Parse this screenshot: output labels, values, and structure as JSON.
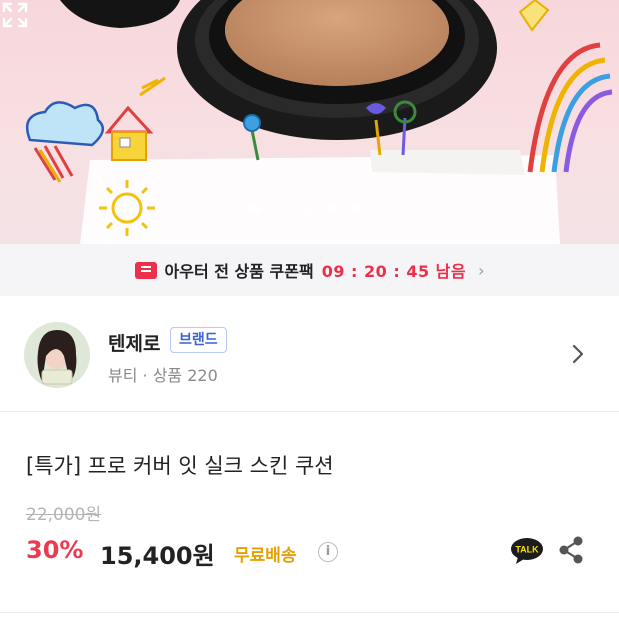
{
  "hero": {
    "slide_count": 5,
    "active_slide": 1,
    "expand_icon": "expand-icon"
  },
  "coupon": {
    "icon": "coupon-icon",
    "text": "아우터 전 상품 쿠폰팩",
    "timer": "09 : 20 : 45 남음",
    "chevron": "›"
  },
  "brand": {
    "name": "텐제로",
    "badge": "브랜드",
    "meta": "뷰티 · 상품 220",
    "chevron_icon": "chevron-right-icon"
  },
  "product": {
    "title": "[특가] 프로 커버 잇 실크 스킨 쿠션",
    "original_price": "22,000원",
    "discount": "30%",
    "price": "15,400원",
    "shipping": "무료배송",
    "info_glyph": "i",
    "talk_label": "TALK",
    "share_icon": "share-icon"
  },
  "colors": {
    "accent_red": "#ec2f4b",
    "shipping_orange": "#e8a000",
    "brand_blue": "#3a62d6"
  }
}
